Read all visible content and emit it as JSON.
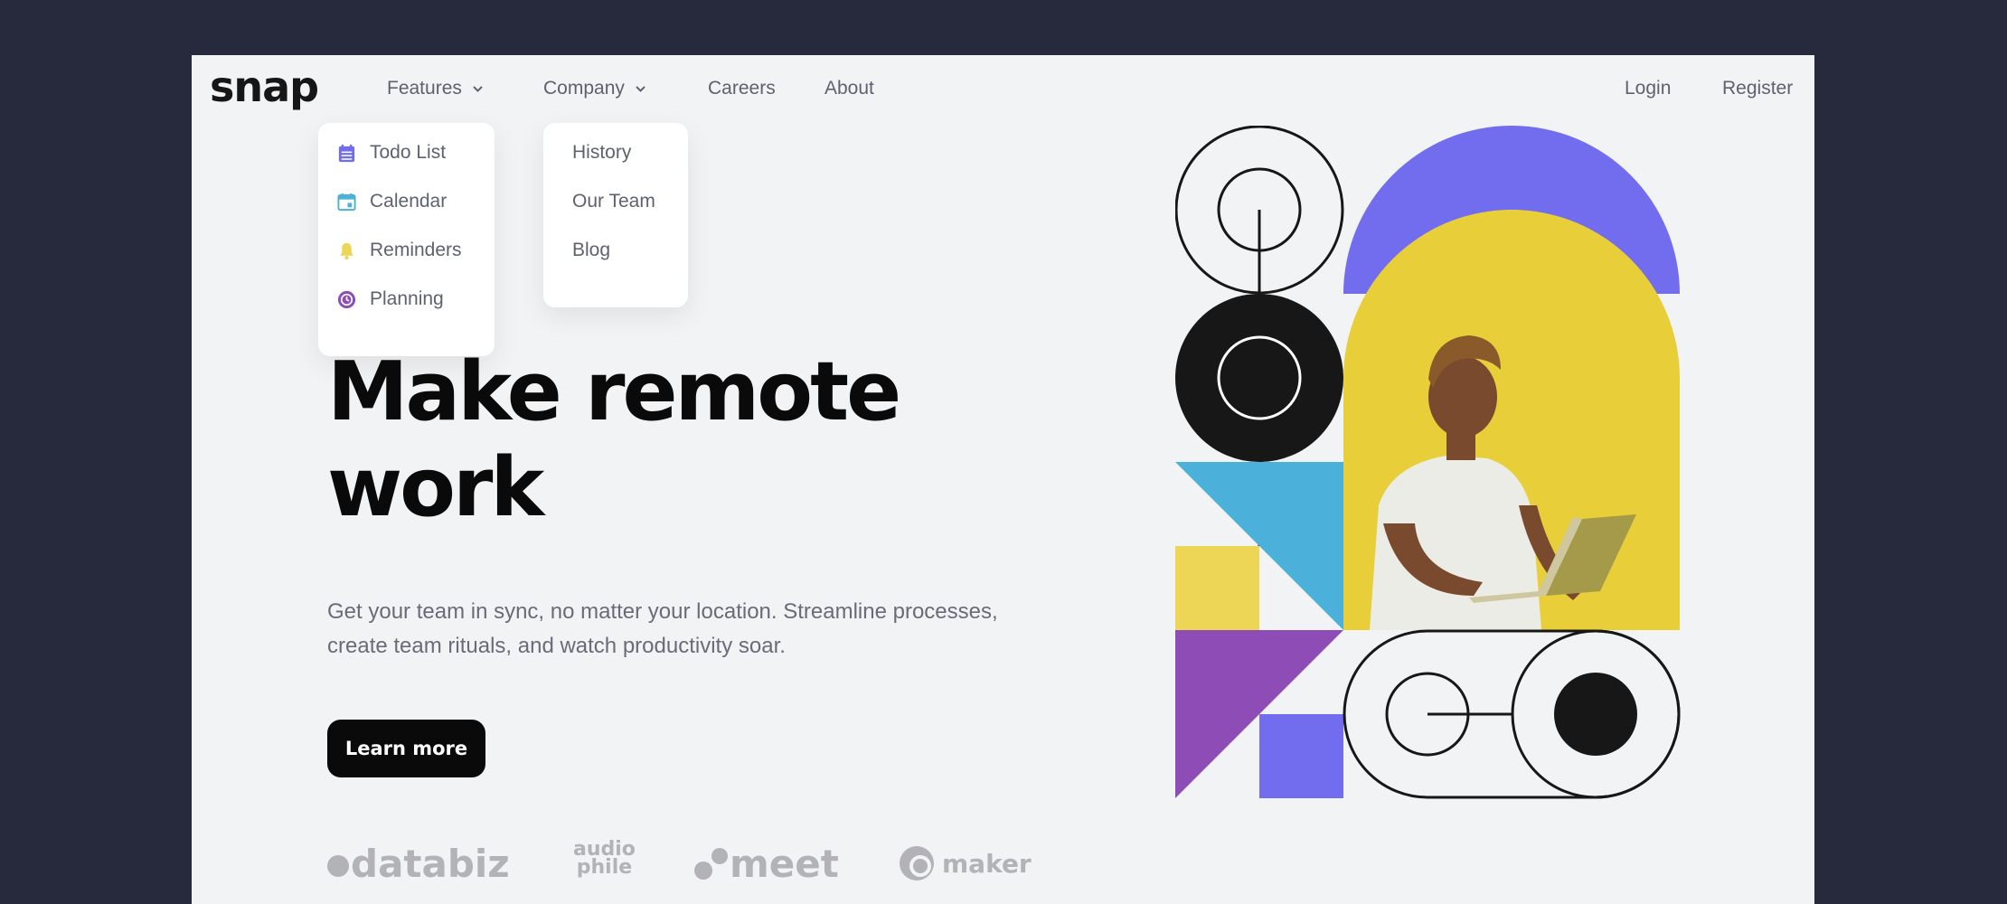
{
  "header": {
    "logo": "snap",
    "nav": {
      "features": "Features",
      "company": "Company",
      "careers": "Careers",
      "about": "About"
    },
    "auth": {
      "login": "Login",
      "register": "Register"
    }
  },
  "features_menu": [
    {
      "label": "Todo List",
      "icon": "calendar-list-icon",
      "color": "#726cee"
    },
    {
      "label": "Calendar",
      "icon": "calendar-icon",
      "color": "#4bb1da"
    },
    {
      "label": "Reminders",
      "icon": "bell-icon",
      "color": "#edd556"
    },
    {
      "label": "Planning",
      "icon": "clock-icon",
      "color": "#8e4cb6"
    }
  ],
  "company_menu": [
    {
      "label": "History"
    },
    {
      "label": "Our Team"
    },
    {
      "label": "Blog"
    }
  ],
  "hero": {
    "title_line1": "Make remote",
    "title_line2": "work",
    "subtitle": "Get your team in sync, no matter your location. Streamline processes, create team rituals, and watch productivity soar.",
    "cta": "Learn more"
  },
  "clients": {
    "databiz": "databiz",
    "audiophile_top": "audio",
    "audiophile_bottom": "phile",
    "meet": "meet",
    "maker": "maker"
  },
  "colors": {
    "page_bg": "#f2f3f5",
    "frame_bg": "#262a3c",
    "purple_accent": "#726cee",
    "blue": "#4bb1da",
    "yellow": "#edd556",
    "violet": "#8e4cb6",
    "text_gray": "#5e6170"
  }
}
